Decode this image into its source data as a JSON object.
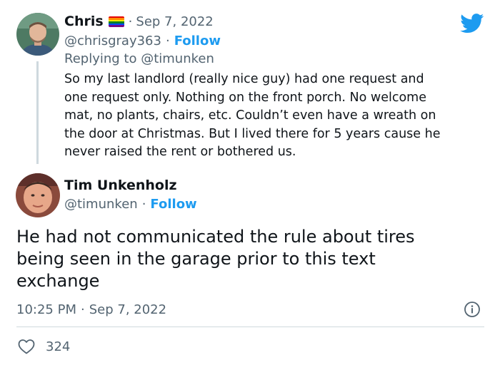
{
  "parent_tweet": {
    "author_name": "Chris",
    "handle": "@chrisgray363",
    "separator": "·",
    "date": "Sep 7, 2022",
    "follow_label": "Follow",
    "replying_prefix": "Replying to ",
    "replying_to": "@timunken",
    "text_lines": [
      "So my last landlord (really nice guy) had one request and",
      "one request only. Nothing on the front porch. No welcome",
      "mat, no plants, chairs, etc. Couldn’t even have a wreath on",
      "the door at Christmas. But I lived there for 5 years cause he",
      "never raised the rent or bothered us."
    ]
  },
  "main_tweet": {
    "author_name": "Tim Unkenholz",
    "handle": "@timunken",
    "separator": "·",
    "follow_label": "Follow",
    "text_lines": [
      "He had not communicated the rule about tires",
      "being seen in the garage prior to this text",
      "exchange"
    ],
    "time": "10:25 PM",
    "date": "Sep 7, 2022",
    "like_count": "324"
  },
  "colors": {
    "accent": "#1d9bf0",
    "muted": "#536471",
    "text": "#0f1419",
    "thread_line": "#cfd9de"
  },
  "icons": [
    "twitter-bird-icon",
    "rainbow-flag-icon",
    "info-icon",
    "heart-icon"
  ]
}
